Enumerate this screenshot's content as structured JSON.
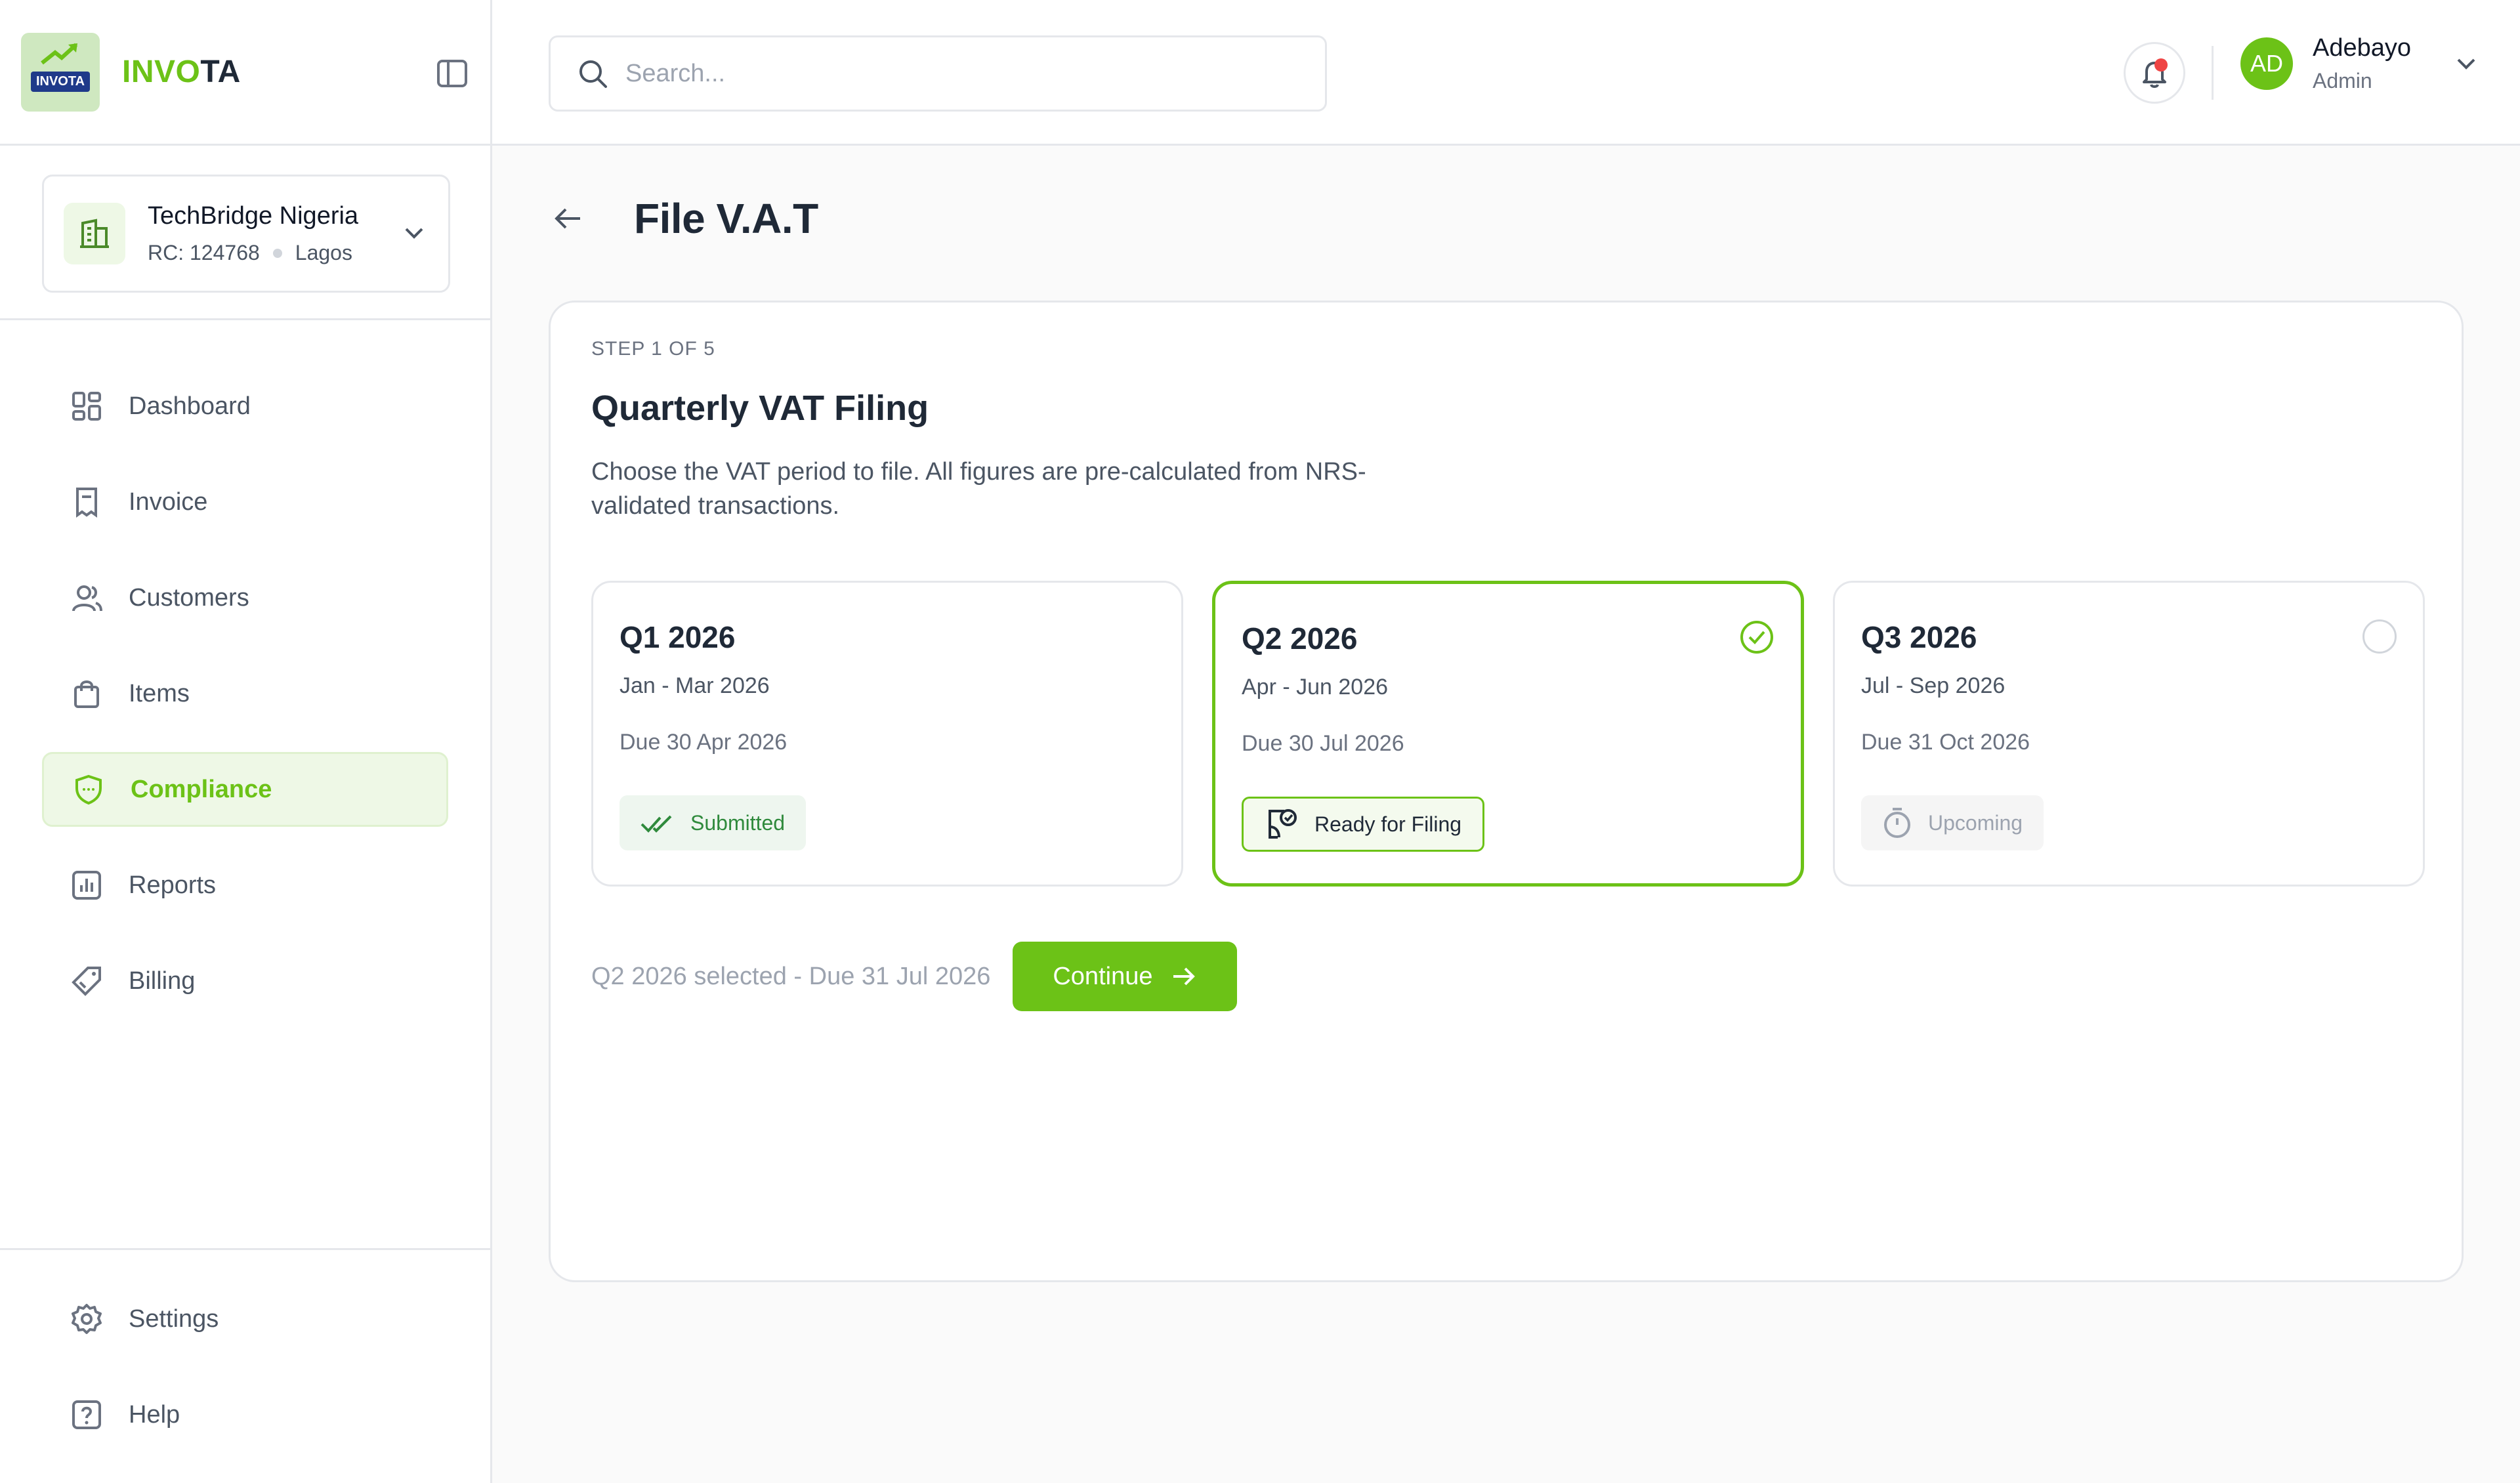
{
  "brand": {
    "logo_text": "INVOTA",
    "name_part1": "INVO",
    "name_part2": "TA"
  },
  "org": {
    "name": "TechBridge Nigeria",
    "rc": "RC: 124768",
    "location": "Lagos"
  },
  "nav": {
    "items": [
      {
        "label": "Dashboard",
        "icon": "grid-icon"
      },
      {
        "label": "Invoice",
        "icon": "receipt-icon"
      },
      {
        "label": "Customers",
        "icon": "users-icon"
      },
      {
        "label": "Items",
        "icon": "shopping-bag-icon"
      },
      {
        "label": "Compliance",
        "icon": "shield-icon",
        "active": true
      },
      {
        "label": "Reports",
        "icon": "bar-chart-icon"
      },
      {
        "label": "Billing",
        "icon": "tag-icon"
      }
    ],
    "bottom": [
      {
        "label": "Settings",
        "icon": "gear-icon"
      },
      {
        "label": "Help",
        "icon": "help-icon"
      }
    ]
  },
  "search": {
    "placeholder": "Search..."
  },
  "user": {
    "initials": "AD",
    "name": "Adebayo",
    "role": "Admin"
  },
  "page": {
    "title": "File V.A.T"
  },
  "filing": {
    "step": "STEP 1 OF 5",
    "title": "Quarterly VAT Filing",
    "description": "Choose the VAT period to file. All figures are pre-calculated from NRS-validated transactions.",
    "periods": [
      {
        "title": "Q1 2026",
        "range": "Jan - Mar 2026",
        "due": "Due 30 Apr 2026",
        "status": "Submitted"
      },
      {
        "title": "Q2 2026",
        "range": "Apr - Jun 2026",
        "due": "Due 30 Jul 2026",
        "status": "Ready for Filing",
        "selected": true
      },
      {
        "title": "Q3 2026",
        "range": "Jul - Sep 2026",
        "due": "Due 31 Oct 2026",
        "status": "Upcoming"
      }
    ],
    "selection_note": "Q2 2026 selected - Due 31 Jul 2026",
    "continue_label": "Continue"
  },
  "colors": {
    "accent": "#6cc217",
    "accent_bg": "#eef8e6",
    "submitted": "#2f8a3c",
    "alert": "#ef4444"
  }
}
